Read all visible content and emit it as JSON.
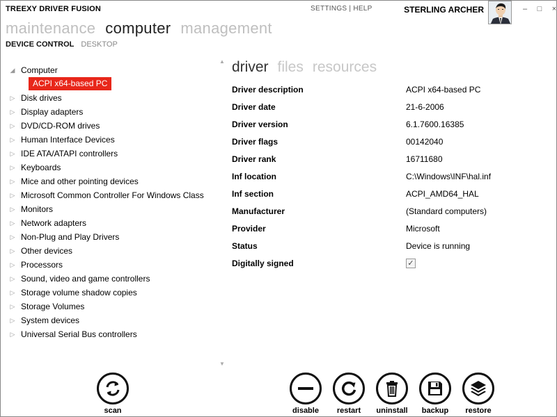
{
  "app": {
    "title": "TREEXY DRIVER FUSION",
    "links": {
      "settings": "SETTINGS",
      "help": "HELP",
      "separator": "|"
    },
    "user": "STERLING ARCHER",
    "window_controls": {
      "minimize": "–",
      "maximize": "□",
      "close": "×"
    }
  },
  "nav": {
    "main": [
      "maintenance",
      "computer",
      "management"
    ],
    "sub": [
      "DEVICE CONTROL",
      "DESKTOP"
    ]
  },
  "tree": {
    "root": "Computer",
    "selected_child": "ACPI x64-based PC",
    "categories": [
      "Disk drives",
      "Display adapters",
      "DVD/CD-ROM drives",
      "Human Interface Devices",
      "IDE ATA/ATAPI controllers",
      "Keyboards",
      "Mice and other pointing devices",
      "Microsoft Common Controller For Windows Class",
      "Monitors",
      "Network adapters",
      "Non-Plug and Play Drivers",
      "Other devices",
      "Processors",
      "Sound, video and game controllers",
      "Storage volume shadow copies",
      "Storage Volumes",
      "System devices",
      "Universal Serial Bus controllers"
    ]
  },
  "tabs": [
    "driver",
    "files",
    "resources"
  ],
  "properties": [
    {
      "label": "Driver description",
      "value": "ACPI x64-based PC"
    },
    {
      "label": "Driver date",
      "value": "21-6-2006"
    },
    {
      "label": "Driver version",
      "value": "6.1.7600.16385"
    },
    {
      "label": "Driver flags",
      "value": "00142040"
    },
    {
      "label": "Driver rank",
      "value": "16711680"
    },
    {
      "label": "Inf location",
      "value": "C:\\Windows\\INF\\hal.inf"
    },
    {
      "label": "Inf section",
      "value": "ACPI_AMD64_HAL"
    },
    {
      "label": "Manufacturer",
      "value": "(Standard computers)"
    },
    {
      "label": "Provider",
      "value": "Microsoft"
    },
    {
      "label": "Status",
      "value": "Device is running"
    }
  ],
  "signed": {
    "label": "Digitally signed",
    "checked": true,
    "check_glyph": "✓"
  },
  "actions": {
    "scan": "scan",
    "disable": "disable",
    "restart": "restart",
    "uninstall": "uninstall",
    "backup": "backup",
    "restore": "restore"
  },
  "glyphs": {
    "expanded": "◢",
    "collapsed": "▷",
    "scroll_up": "▲",
    "scroll_down": "▼"
  },
  "colors": {
    "accent": "#e8271a",
    "inactive_text": "#bfbfbf"
  }
}
